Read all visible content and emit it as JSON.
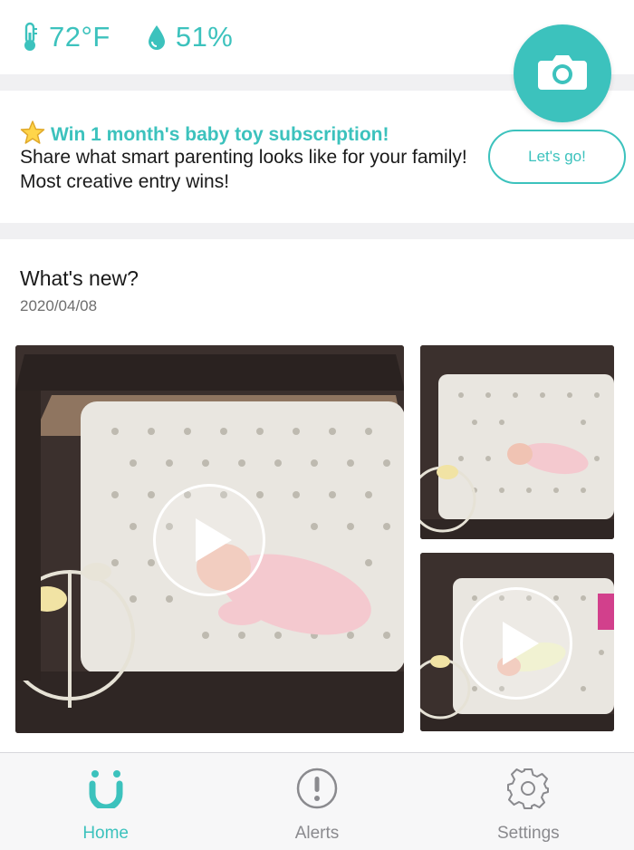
{
  "environment": {
    "temperature": "72°F",
    "humidity": "51%",
    "temperature_icon": "thermometer-icon",
    "humidity_icon": "water-drop-icon"
  },
  "camera_button": {
    "icon": "camera-icon"
  },
  "promo": {
    "title": "Win 1 month's baby toy subscription!",
    "body": "Share what smart parenting looks like for your family! Most creative entry wins!",
    "button_label": "Let's go!",
    "icon": "star-icon"
  },
  "whats_new": {
    "title": "What's new?",
    "date": "2020/04/08",
    "videos": [
      {
        "icon": "play-icon"
      },
      {
        "icon": "none"
      },
      {
        "icon": "play-icon"
      }
    ]
  },
  "tabbar": {
    "tabs": [
      {
        "label": "Home",
        "icon": "home-icon",
        "active": true
      },
      {
        "label": "Alerts",
        "icon": "alert-icon",
        "active": false
      },
      {
        "label": "Settings",
        "icon": "gear-icon",
        "active": false
      }
    ]
  },
  "colors": {
    "accent": "#3cc2bd",
    "band": "#f0f0f2",
    "text": "#1a1a1a",
    "muted": "#8a8a8e"
  }
}
